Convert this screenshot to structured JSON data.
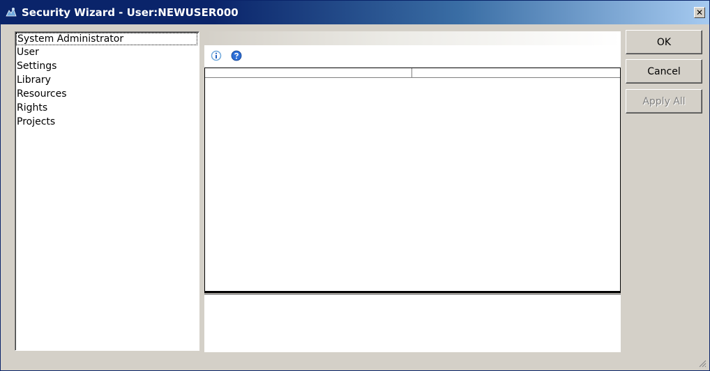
{
  "window": {
    "title": "Security Wizard - User:NEWUSER000"
  },
  "sidebar": {
    "items": [
      {
        "label": "System Administrator",
        "selected": true
      },
      {
        "label": "User"
      },
      {
        "label": "Settings"
      },
      {
        "label": "Library"
      },
      {
        "label": "Resources"
      },
      {
        "label": "Rights"
      },
      {
        "label": "Projects"
      }
    ]
  },
  "toolbar": {
    "icons": [
      "info-icon",
      "help-icon"
    ]
  },
  "buttons": {
    "ok": "OK",
    "cancel": "Cancel",
    "apply_all": "Apply All"
  },
  "colors": {
    "titlebar": "#0a246a",
    "face": "#d4d0c8"
  }
}
